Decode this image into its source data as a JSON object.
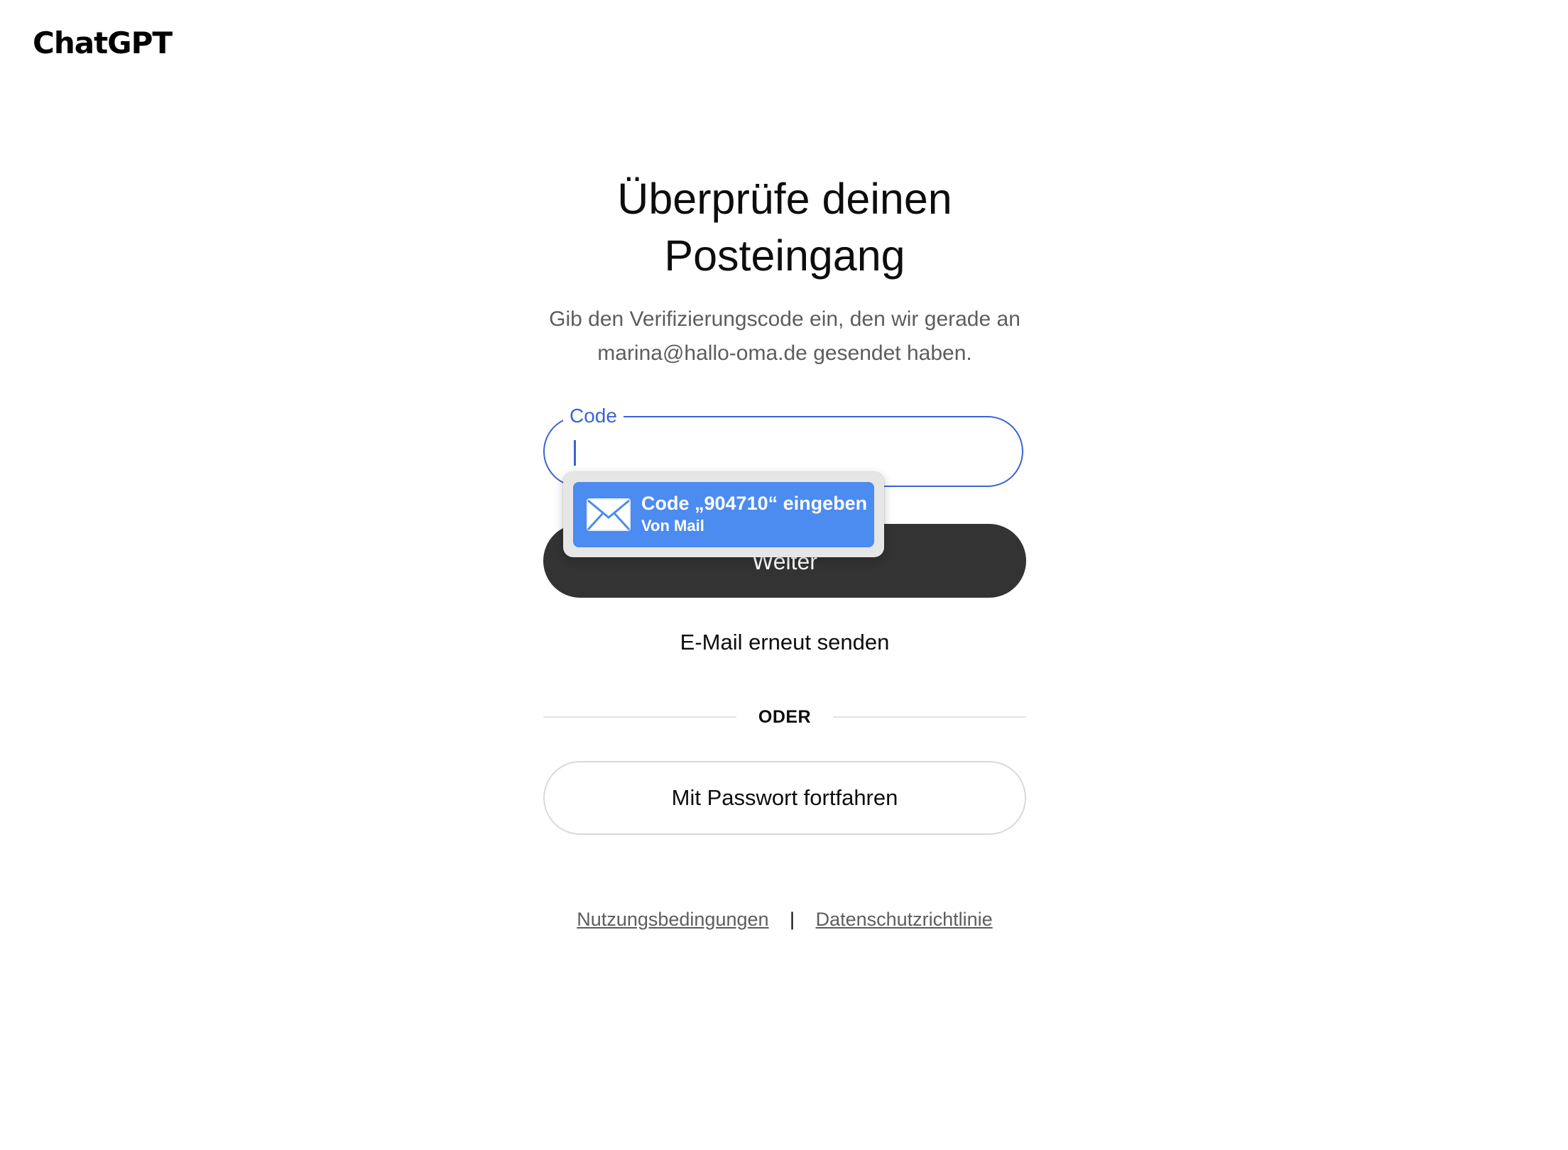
{
  "brand": {
    "logo_text": "ChatGPT"
  },
  "heading": {
    "title": "Überprüfe deinen Posteingang",
    "subtitle": "Gib den Verifizierungscode ein, den wir gerade an marina@hallo-oma.de gesendet haben."
  },
  "code_field": {
    "label": "Code",
    "value": "",
    "accent_color": "#3b63d6"
  },
  "autofill": {
    "icon": "mail-icon",
    "title": "Code „904710“ eingeben",
    "source": "Von Mail",
    "highlight_color": "#4c8bf0"
  },
  "actions": {
    "continue_label": "Weiter",
    "resend_label": "E-Mail erneut senden",
    "divider_label": "ODER",
    "password_label": "Mit Passwort fortfahren"
  },
  "footer": {
    "terms_label": "Nutzungsbedingungen",
    "separator": "|",
    "privacy_label": "Datenschutzrichtlinie"
  }
}
